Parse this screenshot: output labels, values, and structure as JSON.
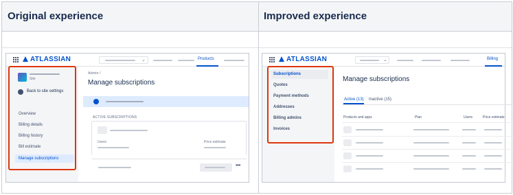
{
  "headers": {
    "left": "Original experience",
    "right": "Improved experience"
  },
  "original": {
    "logo": "ATLASSIAN",
    "nav_active_tab": "Products",
    "site_label": "Site",
    "back_label": "Back to site settings",
    "sidebar_items": [
      "Overview",
      "Billing details",
      "Billing history",
      "Bill estimate",
      "Manage subscriptions"
    ],
    "selected_item": "Manage subscriptions",
    "breadcrumb": "Admin  /",
    "page_title": "Manage subscriptions",
    "section_heading": "ACTIVE SUBSCRIPTIONS",
    "users_label": "Users",
    "price_label": "Price estimate",
    "more_icon": "more-horizontal-icon"
  },
  "improved": {
    "logo": "ATLASSIAN",
    "nav_active_tab": "Billing",
    "sidebar_items": [
      "Subscriptions",
      "Quotes",
      "Payment methods",
      "Addresses",
      "Billing admins",
      "Invoices"
    ],
    "selected_item": "Subscriptions",
    "page_title": "Manage subscriptions",
    "tabs": [
      "Active (13)",
      "Inactive (15)"
    ],
    "columns": [
      "Products and apps",
      "Plan",
      "Users",
      "Price estimate"
    ]
  },
  "colors": {
    "highlight": "#DE350B",
    "brand": "#0052CC"
  }
}
